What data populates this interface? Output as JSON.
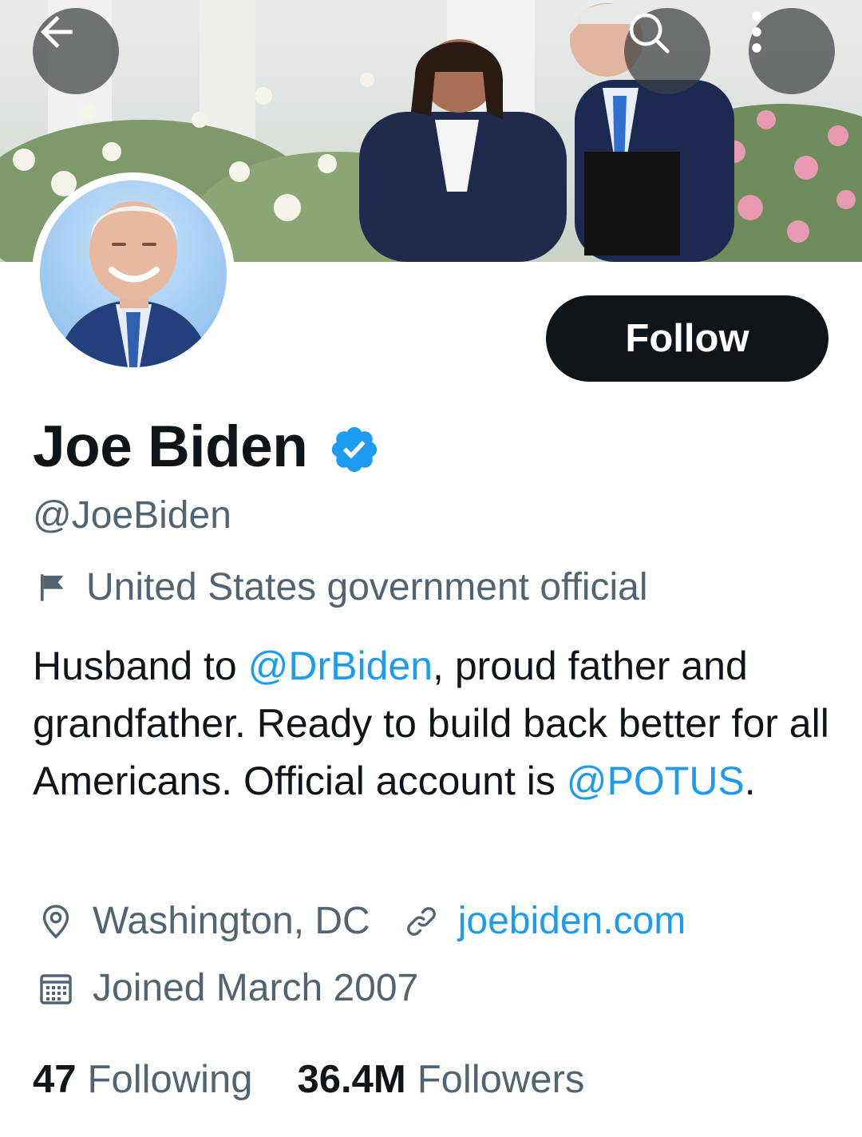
{
  "header": {
    "back_icon": "arrow-left-icon",
    "search_icon": "search-icon",
    "more_icon": "more-vertical-icon"
  },
  "banner": {
    "image": "photo of two people smiling outdoors in front of roses"
  },
  "profile": {
    "display_name": "Joe Biden",
    "verified_icon": "verified-badge-icon",
    "handle": "@JoeBiden",
    "affiliation": "United States government official",
    "follow_label": "Follow",
    "bio": {
      "p1": "Husband to ",
      "mention1": "@DrBiden",
      "p2": ", proud father and grandfather. Ready to build back better for all Americans. Official account is ",
      "mention2": "@POTUS",
      "p3": "."
    },
    "location": "Washington, DC",
    "website": "joebiden.com",
    "joined": "Joined March 2007",
    "following_count": "47",
    "following_label": "Following",
    "followers_count": "36.4M",
    "followers_label": "Followers"
  },
  "colors": {
    "accent": "#1d9bf0",
    "text": "#0f1419",
    "secondary": "#536471",
    "button": "#0f1419"
  }
}
